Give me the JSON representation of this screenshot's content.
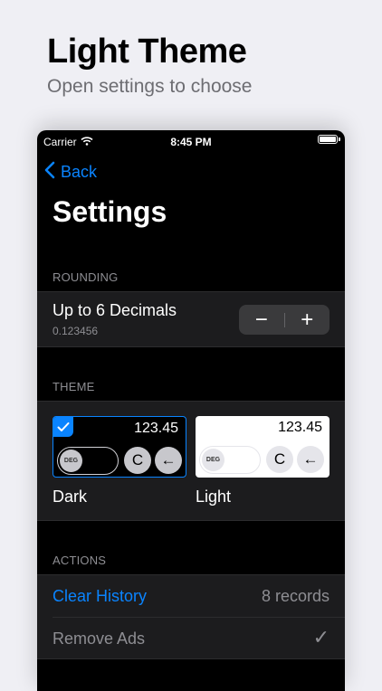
{
  "promo": {
    "title": "Light Theme",
    "subtitle": "Open settings to choose"
  },
  "status_bar": {
    "carrier": "Carrier",
    "time": "8:45 PM"
  },
  "nav": {
    "back_label": "Back",
    "title": "Settings"
  },
  "rounding": {
    "header": "ROUNDING",
    "label": "Up to 6 Decimals",
    "example": "0.123456",
    "decrement": "−",
    "increment": "+"
  },
  "theme": {
    "header": "THEME",
    "dark": {
      "label": "Dark",
      "value": "123.45",
      "toggle_text": "DEG",
      "clear_label": "C",
      "back_label": "←",
      "selected": true
    },
    "light": {
      "label": "Light",
      "value": "123.45",
      "toggle_text": "DEG",
      "clear_label": "C",
      "back_label": "←",
      "selected": false
    }
  },
  "actions": {
    "header": "ACTIONS",
    "clear_history": {
      "label": "Clear History",
      "value": "8 records"
    },
    "remove_ads": {
      "label": "Remove Ads",
      "value": "✓"
    }
  },
  "colors": {
    "accent": "#0a84ff",
    "background": "#efeff4",
    "cell": "#1c1c1e",
    "secondary_text": "#8e8e93"
  }
}
